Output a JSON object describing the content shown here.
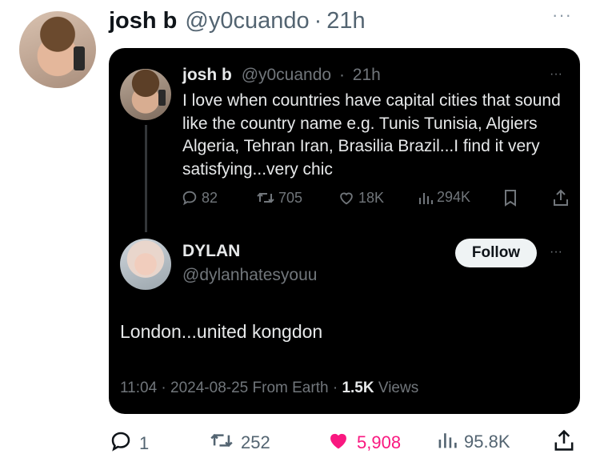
{
  "colors": {
    "like": "#f91880",
    "card_bg": "#000000",
    "muted": "#536471"
  },
  "outer_tweet": {
    "name": "josh b",
    "handle": "@y0cuando",
    "dot": "·",
    "time": "21h",
    "more": "···",
    "avatar_icon": "avatar",
    "actions": {
      "reply": {
        "icon": "reply-icon",
        "count": "1"
      },
      "retweet": {
        "icon": "retweet-icon",
        "count": "252"
      },
      "like": {
        "icon": "heart-filled-icon",
        "count": "5,908"
      },
      "views": {
        "icon": "views-icon",
        "count": "95.8K"
      },
      "share": {
        "icon": "share-icon"
      }
    }
  },
  "quoted_tweet": {
    "name": "josh b",
    "handle": "@y0cuando",
    "dot": "·",
    "time": "21h",
    "more": "···",
    "text": "I love when countries have capital cities that sound like the country name e.g. Tunis Tunisia, Algiers Algeria, Tehran Iran, Brasilia Brazil...I find it very satisfying...very chic",
    "actions": {
      "reply": {
        "icon": "reply-icon",
        "count": "82"
      },
      "retweet": {
        "icon": "retweet-icon",
        "count": "705"
      },
      "like": {
        "icon": "heart-icon",
        "count": "18K"
      },
      "views": {
        "icon": "views-icon",
        "count": "294K"
      },
      "bookmark": {
        "icon": "bookmark-icon"
      },
      "share": {
        "icon": "share-icon"
      }
    }
  },
  "reply_tweet": {
    "name": "DYLAN",
    "handle": "@dylanhatesyouu",
    "follow_label": "Follow",
    "more": "···",
    "text": "London...united kongdon",
    "time": "11:04",
    "sep1": "·",
    "date": "2024-08-25",
    "source": "From Earth",
    "sep2": "·",
    "views_count": "1.5K",
    "views_label": "Views"
  }
}
